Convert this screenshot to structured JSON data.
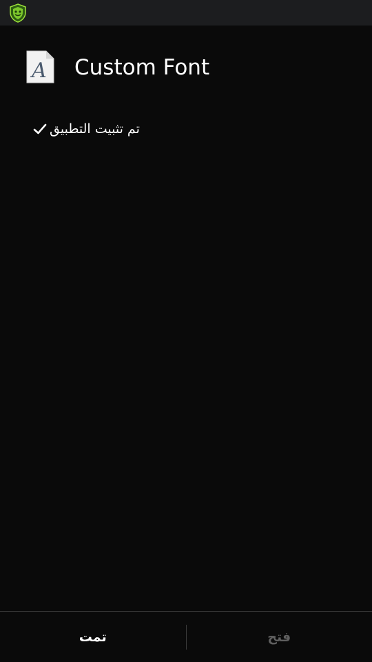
{
  "status_bar": {
    "icons": [
      "shield-app-icon"
    ]
  },
  "app": {
    "title": "Custom Font",
    "icon": "font-file-icon"
  },
  "install": {
    "status_text": "تم تثبيت التطبيق",
    "icon": "check-icon"
  },
  "actions": {
    "done_label": "تمت",
    "open_label": "فتح"
  },
  "colors": {
    "background": "#0a0a0a",
    "status_bar": "#1c1d1f",
    "text": "#ffffff",
    "disabled_text": "#5f5f5f",
    "accent_green": "#7cc72c"
  }
}
